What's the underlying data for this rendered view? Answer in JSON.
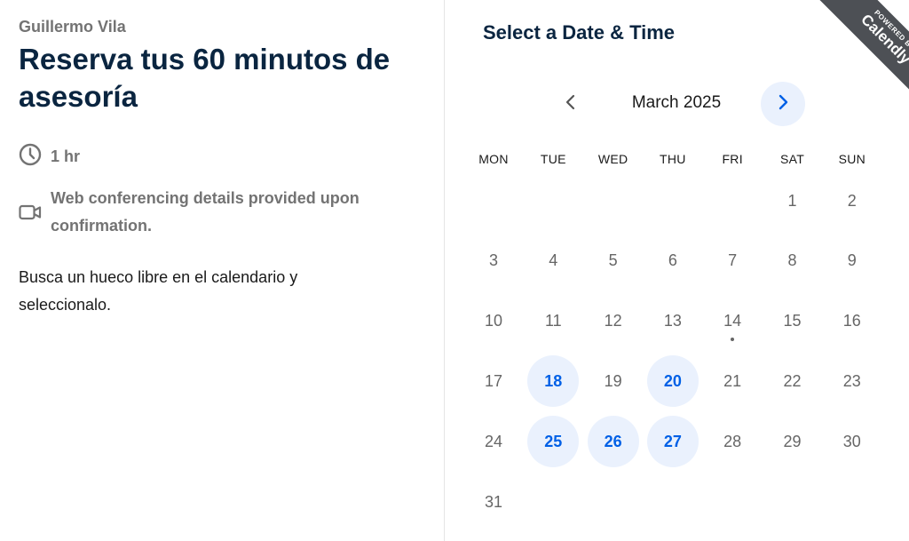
{
  "event": {
    "host": "Guillermo Vila",
    "title": "Reserva tus 60 minutos de asesoría",
    "duration": "1 hr",
    "conferencing": "Web conferencing details provided upon confirmation.",
    "description": "Busca un hueco libre en el calendario y seleccionalo."
  },
  "scheduler": {
    "title": "Select a Date & Time",
    "month": "March 2025",
    "weekdays": [
      "MON",
      "TUE",
      "WED",
      "THU",
      "FRI",
      "SAT",
      "SUN"
    ],
    "weeks": [
      [
        "",
        "",
        "",
        "",
        "",
        "1",
        "2"
      ],
      [
        "3",
        "4",
        "5",
        "6",
        "7",
        "8",
        "9"
      ],
      [
        "10",
        "11",
        "12",
        "13",
        "14",
        "15",
        "16"
      ],
      [
        "17",
        "18",
        "19",
        "20",
        "21",
        "22",
        "23"
      ],
      [
        "24",
        "25",
        "26",
        "27",
        "28",
        "29",
        "30"
      ],
      [
        "31",
        "",
        "",
        "",
        "",
        "",
        ""
      ]
    ],
    "available_days": [
      "18",
      "20",
      "25",
      "26",
      "27"
    ],
    "today": "14"
  },
  "badge": {
    "line1": "POWERED BY",
    "line2": "Calendly"
  },
  "colors": {
    "accent": "#0060e6",
    "accent_bg": "#eaf1fd",
    "heading": "#0a2540",
    "muted": "#737373"
  },
  "icons": {
    "duration": "clock-icon",
    "conferencing": "video-camera-icon",
    "prev": "chevron-left-icon",
    "next": "chevron-right-icon"
  }
}
